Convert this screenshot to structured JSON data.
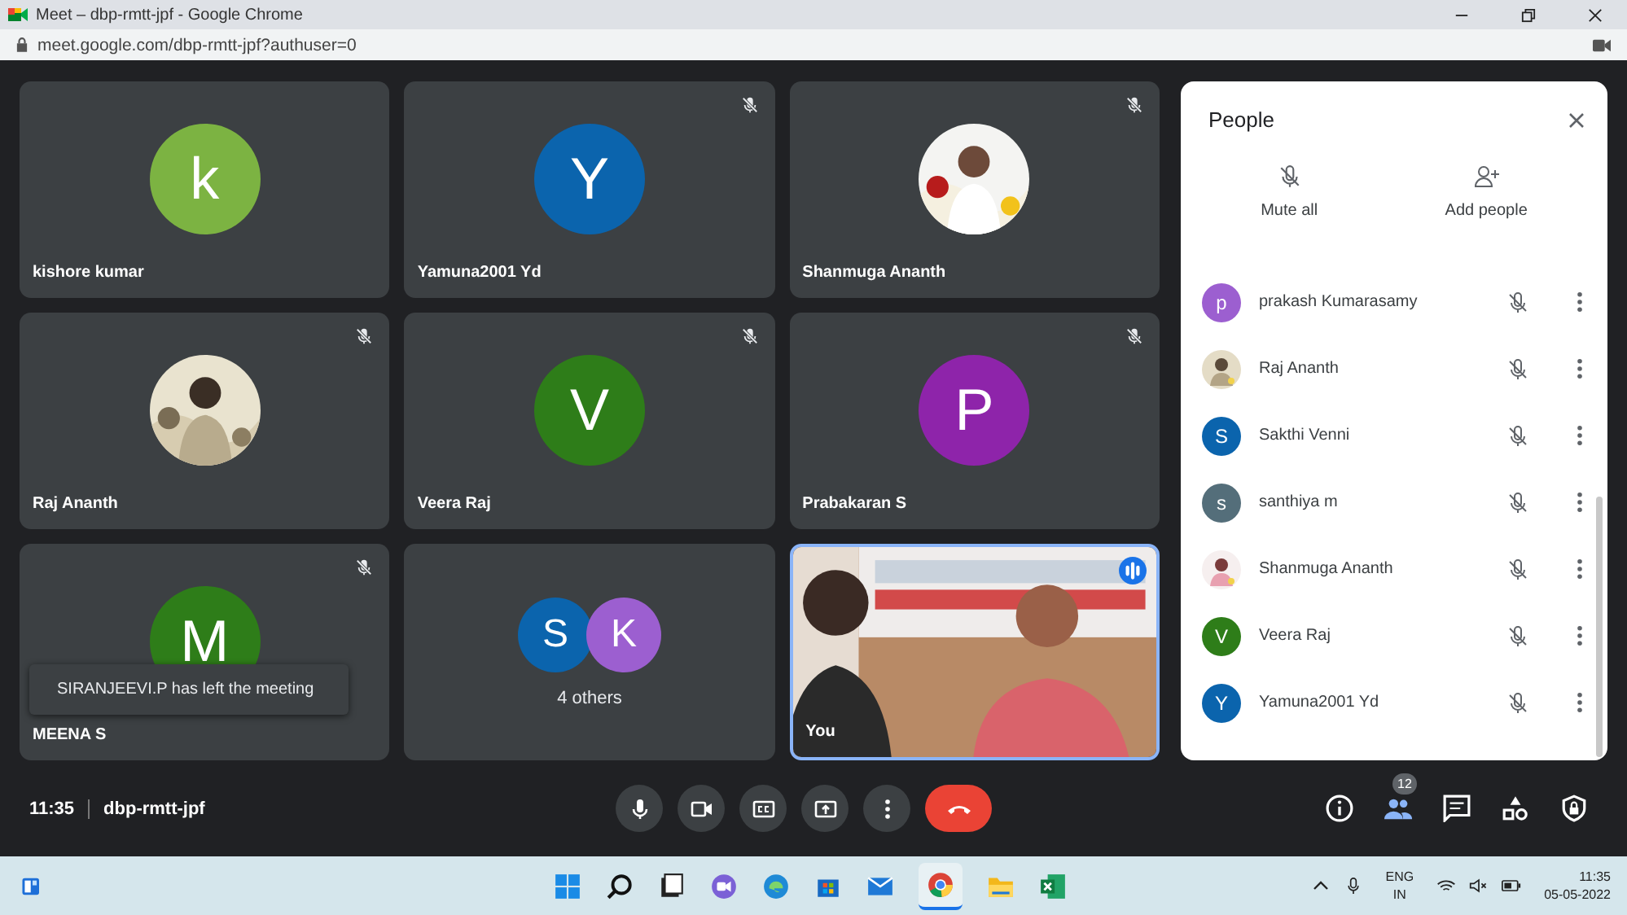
{
  "window": {
    "title": "Meet – dbp-rmtt-jpf - Google Chrome"
  },
  "address_bar": {
    "url": "meet.google.com/dbp-rmtt-jpf?authuser=0"
  },
  "tiles": [
    {
      "kind": "avatar",
      "name": "kishore kumar",
      "letter": "k",
      "color": "#7cb342",
      "muted": false
    },
    {
      "kind": "avatar",
      "name": "Yamuna2001 Yd",
      "letter": "Y",
      "color": "#0b64ad",
      "muted": true
    },
    {
      "name": "Shanmuga Ananth",
      "muted": true
    },
    {
      "name": "Raj Ananth",
      "muted": true
    },
    {
      "kind": "avatar",
      "name": "Veera Raj",
      "letter": "V",
      "color": "#2e7d19",
      "muted": true
    },
    {
      "kind": "avatar",
      "name": "Prabakaran S",
      "letter": "P",
      "color": "#8e24aa",
      "muted": true
    },
    {
      "kind": "avatar",
      "name": "MEENA S",
      "letter": "M",
      "color": "#2e7d19",
      "muted": true
    },
    {
      "kind": "group",
      "label": "4 others",
      "avatars": [
        {
          "letter": "S",
          "color": "#0b64ad"
        },
        {
          "letter": "K",
          "color": "#9c5fd0"
        }
      ]
    },
    {
      "kind": "video",
      "name": "You",
      "speaking": true
    }
  ],
  "toast": {
    "text": "SIRANJEEVI.P has left the meeting"
  },
  "people_panel": {
    "title": "People",
    "actions": [
      "Mute all",
      "Add people"
    ],
    "participants": [
      {
        "name": "prakash Kumarasamy",
        "kind": "letter",
        "letter": "p",
        "color": "#9c5fd0"
      },
      {
        "name": "Raj Ananth"
      },
      {
        "name": "Sakthi Venni",
        "kind": "letter",
        "letter": "S",
        "color": "#0b64ad"
      },
      {
        "name": "santhiya m",
        "kind": "letter",
        "letter": "s",
        "color": "#546e7a"
      },
      {
        "name": "Shanmuga Ananth"
      },
      {
        "name": "Veera Raj",
        "kind": "letter",
        "letter": "V",
        "color": "#2e7d19"
      },
      {
        "name": "Yamuna2001 Yd",
        "kind": "letter",
        "letter": "Y",
        "color": "#0b64ad"
      }
    ]
  },
  "meeting_bar": {
    "time": "11:35",
    "code": "dbp-rmtt-jpf",
    "people_count": "12"
  },
  "taskbar": {
    "language": "ENG",
    "region": "IN",
    "time": "11:35",
    "date": "05-05-2022"
  }
}
